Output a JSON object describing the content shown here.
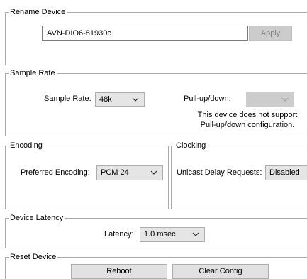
{
  "rename_device": {
    "title": "Rename Device",
    "device_name_value": "AVN-DIO6-81930c",
    "apply_label": "Apply"
  },
  "sample_rate": {
    "title": "Sample Rate",
    "sample_rate_label": "Sample Rate:",
    "sample_rate_value": "48k",
    "pullupdown_label": "Pull-up/down:",
    "pullupdown_value": "",
    "note_line1": "This device does not support",
    "note_line2": "Pull-up/down configuration."
  },
  "encoding": {
    "title": "Encoding",
    "preferred_label": "Preferred Encoding:",
    "preferred_value": "PCM 24"
  },
  "clocking": {
    "title": "Clocking",
    "unicast_label": "Unicast Delay Requests:",
    "unicast_value": "Disabled"
  },
  "device_latency": {
    "title": "Device Latency",
    "latency_label": "Latency:",
    "latency_value": "1.0 msec"
  },
  "reset_device": {
    "title": "Reset Device",
    "reboot_label": "Reboot",
    "clear_config_label": "Clear Config"
  },
  "icons": {
    "dropdown": "chevron-down-icon"
  },
  "colors": {
    "button_face": "#e1e1e1",
    "disabled_face": "#cccccc",
    "frame": "#a9a9a9"
  }
}
